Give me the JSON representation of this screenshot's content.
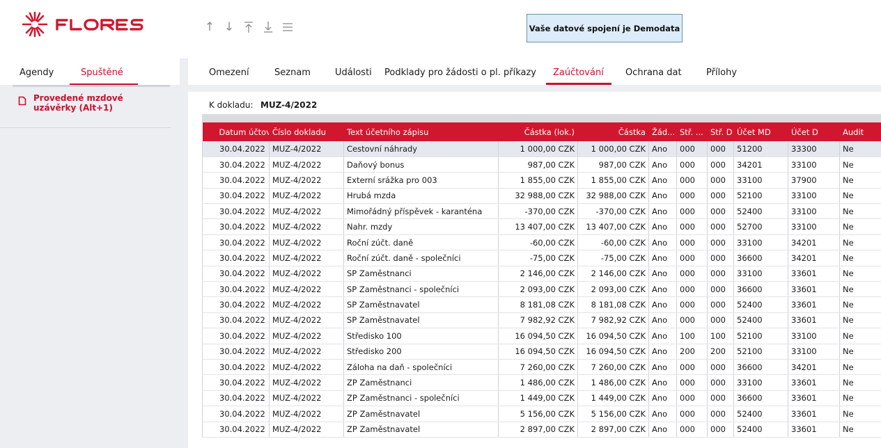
{
  "app": {
    "brand": "FLORES",
    "connection_text": "Vaše datové spojení je Demodata",
    "nav_icons": [
      "arrow-up-icon",
      "arrow-down-icon",
      "arrow-to-top-icon",
      "arrow-to-bottom-icon",
      "menu-icon"
    ]
  },
  "sidebar": {
    "tabs": [
      {
        "label": "Agendy",
        "active": false
      },
      {
        "label": "Spuštěné",
        "active": true
      }
    ],
    "items": [
      {
        "label": "Provedené mzdové uzávěrky (Alt+1)",
        "icon": "document-icon"
      }
    ]
  },
  "main": {
    "tabs": [
      {
        "label": "Omezení",
        "active": false
      },
      {
        "label": "Seznam",
        "active": false
      },
      {
        "label": "Události",
        "active": false
      },
      {
        "label": "Podklady pro žádosti o pl. příkazy",
        "active": false
      },
      {
        "label": "Zaúčtování",
        "active": true
      },
      {
        "label": "Ochrana dat",
        "active": false
      },
      {
        "label": "Přílohy",
        "active": false
      }
    ],
    "doc_label": "K dokladu:",
    "doc_value": "MUZ-4/2022"
  },
  "table": {
    "columns": [
      "Datum účtov...",
      "Číslo dokladu",
      "Text účetního zápisu",
      "Částka (lok.)",
      "Částka",
      "Žád...",
      "Stř. ...",
      "Stř. D",
      "Účet MD",
      "Účet D",
      "Audit"
    ],
    "rows": [
      [
        "30.04.2022",
        "MUZ-4/2022",
        "Cestovní náhrady",
        "1 000,00 CZK",
        "1 000,00 CZK",
        "Ano",
        "000",
        "000",
        "51200",
        "33300",
        "Ne"
      ],
      [
        "30.04.2022",
        "MUZ-4/2022",
        "Daňový bonus",
        "987,00 CZK",
        "987,00 CZK",
        "Ano",
        "000",
        "000",
        "34201",
        "33100",
        "Ne"
      ],
      [
        "30.04.2022",
        "MUZ-4/2022",
        "Externí srážka pro 003",
        "1 855,00 CZK",
        "1 855,00 CZK",
        "Ano",
        "000",
        "000",
        "33100",
        "37900",
        "Ne"
      ],
      [
        "30.04.2022",
        "MUZ-4/2022",
        "Hrubá mzda",
        "32 988,00 CZK",
        "32 988,00 CZK",
        "Ano",
        "000",
        "000",
        "52100",
        "33100",
        "Ne"
      ],
      [
        "30.04.2022",
        "MUZ-4/2022",
        "Mimořádný příspěvek - karanténa",
        "-370,00 CZK",
        "-370,00 CZK",
        "Ano",
        "000",
        "000",
        "52400",
        "33100",
        "Ne"
      ],
      [
        "30.04.2022",
        "MUZ-4/2022",
        "Nahr. mzdy",
        "13 407,00 CZK",
        "13 407,00 CZK",
        "Ano",
        "000",
        "000",
        "52700",
        "33100",
        "Ne"
      ],
      [
        "30.04.2022",
        "MUZ-4/2022",
        "Roční zúčt. daně",
        "-60,00 CZK",
        "-60,00 CZK",
        "Ano",
        "000",
        "000",
        "33100",
        "34201",
        "Ne"
      ],
      [
        "30.04.2022",
        "MUZ-4/2022",
        "Roční zúčt. daně - společníci",
        "-75,00 CZK",
        "-75,00 CZK",
        "Ano",
        "000",
        "000",
        "36600",
        "34201",
        "Ne"
      ],
      [
        "30.04.2022",
        "MUZ-4/2022",
        "SP Zaměstnanci",
        "2 146,00 CZK",
        "2 146,00 CZK",
        "Ano",
        "000",
        "000",
        "33100",
        "33601",
        "Ne"
      ],
      [
        "30.04.2022",
        "MUZ-4/2022",
        "SP Zaměstnanci - společníci",
        "2 093,00 CZK",
        "2 093,00 CZK",
        "Ano",
        "000",
        "000",
        "36600",
        "33601",
        "Ne"
      ],
      [
        "30.04.2022",
        "MUZ-4/2022",
        "SP Zaměstnavatel",
        "8 181,08 CZK",
        "8 181,08 CZK",
        "Ano",
        "000",
        "000",
        "52400",
        "33601",
        "Ne"
      ],
      [
        "30.04.2022",
        "MUZ-4/2022",
        "SP Zaměstnavatel",
        "7 982,92 CZK",
        "7 982,92 CZK",
        "Ano",
        "000",
        "000",
        "52400",
        "33601",
        "Ne"
      ],
      [
        "30.04.2022",
        "MUZ-4/2022",
        "Středisko 100",
        "16 094,50 CZK",
        "16 094,50 CZK",
        "Ano",
        "100",
        "100",
        "52100",
        "33100",
        "Ne"
      ],
      [
        "30.04.2022",
        "MUZ-4/2022",
        "Středisko 200",
        "16 094,50 CZK",
        "16 094,50 CZK",
        "Ano",
        "200",
        "200",
        "52100",
        "33100",
        "Ne"
      ],
      [
        "30.04.2022",
        "MUZ-4/2022",
        "Záloha na daň - společníci",
        "7 260,00 CZK",
        "7 260,00 CZK",
        "Ano",
        "000",
        "000",
        "36600",
        "34201",
        "Ne"
      ],
      [
        "30.04.2022",
        "MUZ-4/2022",
        "ZP Zaměstnanci",
        "1 486,00 CZK",
        "1 486,00 CZK",
        "Ano",
        "000",
        "000",
        "33100",
        "33601",
        "Ne"
      ],
      [
        "30.04.2022",
        "MUZ-4/2022",
        "ZP Zaměstnanci - společníci",
        "1 449,00 CZK",
        "1 449,00 CZK",
        "Ano",
        "000",
        "000",
        "36600",
        "33601",
        "Ne"
      ],
      [
        "30.04.2022",
        "MUZ-4/2022",
        "ZP Zaměstnavatel",
        "5 156,00 CZK",
        "5 156,00 CZK",
        "Ano",
        "000",
        "000",
        "52400",
        "33601",
        "Ne"
      ],
      [
        "30.04.2022",
        "MUZ-4/2022",
        "ZP Zaměstnavatel",
        "2 897,00 CZK",
        "2 897,00 CZK",
        "Ano",
        "000",
        "000",
        "52400",
        "33601",
        "Ne"
      ]
    ]
  },
  "colors": {
    "accent": "#c8102e",
    "header_bg": "#d1172f",
    "panel_bg": "#eceef2",
    "info_box_bg": "#dcecf8"
  }
}
